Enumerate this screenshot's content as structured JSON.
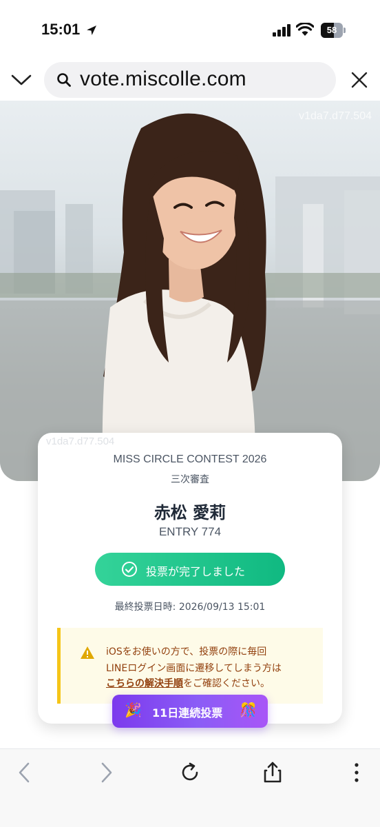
{
  "status_bar": {
    "time": "15:01",
    "battery_level": "58",
    "icons": [
      "location-arrow-icon",
      "signal-icon",
      "wifi-icon",
      "battery-icon"
    ]
  },
  "browser": {
    "url": "vote.miscolle.com",
    "icons": [
      "chevron-down-icon",
      "search-icon",
      "close-icon"
    ]
  },
  "hero": {
    "watermark": "v1da7.d77.504"
  },
  "card": {
    "watermark": "v1da7.d77.504",
    "contest_title": "MISS CIRCLE CONTEST 2026",
    "stage": "三次審査",
    "name": "赤松 愛莉",
    "entry": "ENTRY 774",
    "vote_status": "投票が完了しました",
    "last_vote": "最終投票日時: 2026/09/13 15:01",
    "notice": {
      "line1": "iOSをお使いの方で、投票の際に毎回",
      "line2": "LINEログイン画面に遷移してしまう方は",
      "link": "こちらの解決手順",
      "line3_rest": "をご確認ください。"
    },
    "streak": {
      "label": "11日連続投票",
      "emoji_left": "🎉",
      "emoji_right": "🎊"
    }
  },
  "colors": {
    "vote_green": "#10b981",
    "streak_purple": "#7c3aed",
    "notice_bg": "#fefbe8",
    "notice_border": "#f5c518",
    "notice_text": "#92400e"
  },
  "toolbar": {
    "icons": [
      "back-icon",
      "forward-icon",
      "reload-icon",
      "share-icon",
      "more-icon"
    ]
  }
}
